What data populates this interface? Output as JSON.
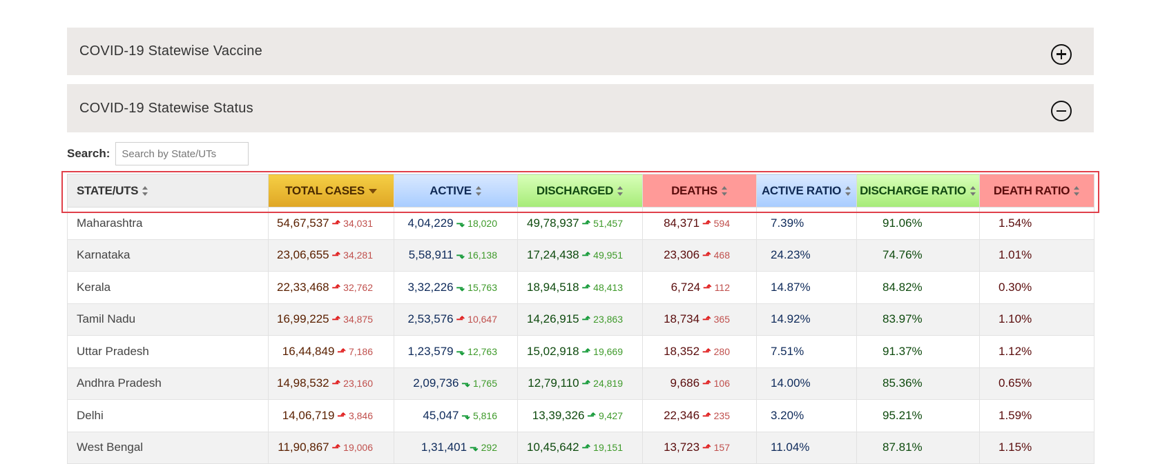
{
  "accordions": [
    {
      "title": "COVID-19 Statewise Vaccine",
      "icon": "plus-circle-icon"
    },
    {
      "title": "COVID-19 Statewise Status",
      "icon": "minus-circle-icon"
    }
  ],
  "search": {
    "label": "Search:",
    "placeholder": "Search by State/UTs",
    "value": ""
  },
  "table": {
    "headers": {
      "state": "STATE/UTS",
      "total": "TOTAL CASES",
      "active": "ACTIVE",
      "discharged": "DISCHARGED",
      "deaths": "DEATHS",
      "active_ratio": "ACTIVE RATIO",
      "discharge_ratio": "DISCHARGE RATIO",
      "death_ratio": "DEATH RATIO"
    },
    "rows": [
      {
        "state": "Maharashtra",
        "total": "54,67,537",
        "total_delta": "34,031",
        "active": "4,04,229",
        "active_delta": "18,020",
        "active_dir": "down",
        "discharged": "49,78,937",
        "discharged_delta": "51,457",
        "deaths": "84,371",
        "deaths_delta": "594",
        "active_ratio": "7.39%",
        "discharge_ratio": "91.06%",
        "death_ratio": "1.54%"
      },
      {
        "state": "Karnataka",
        "total": "23,06,655",
        "total_delta": "34,281",
        "active": "5,58,911",
        "active_delta": "16,138",
        "active_dir": "down",
        "discharged": "17,24,438",
        "discharged_delta": "49,951",
        "deaths": "23,306",
        "deaths_delta": "468",
        "active_ratio": "24.23%",
        "discharge_ratio": "74.76%",
        "death_ratio": "1.01%"
      },
      {
        "state": "Kerala",
        "total": "22,33,468",
        "total_delta": "32,762",
        "active": "3,32,226",
        "active_delta": "15,763",
        "active_dir": "down",
        "discharged": "18,94,518",
        "discharged_delta": "48,413",
        "deaths": "6,724",
        "deaths_delta": "112",
        "active_ratio": "14.87%",
        "discharge_ratio": "84.82%",
        "death_ratio": "0.30%"
      },
      {
        "state": "Tamil Nadu",
        "total": "16,99,225",
        "total_delta": "34,875",
        "active": "2,53,576",
        "active_delta": "10,647",
        "active_dir": "up",
        "discharged": "14,26,915",
        "discharged_delta": "23,863",
        "deaths": "18,734",
        "deaths_delta": "365",
        "active_ratio": "14.92%",
        "discharge_ratio": "83.97%",
        "death_ratio": "1.10%"
      },
      {
        "state": "Uttar Pradesh",
        "total": "16,44,849",
        "total_delta": "7,186",
        "active": "1,23,579",
        "active_delta": "12,763",
        "active_dir": "down",
        "discharged": "15,02,918",
        "discharged_delta": "19,669",
        "deaths": "18,352",
        "deaths_delta": "280",
        "active_ratio": "7.51%",
        "discharge_ratio": "91.37%",
        "death_ratio": "1.12%"
      },
      {
        "state": "Andhra Pradesh",
        "total": "14,98,532",
        "total_delta": "23,160",
        "active": "2,09,736",
        "active_delta": "1,765",
        "active_dir": "down",
        "discharged": "12,79,110",
        "discharged_delta": "24,819",
        "deaths": "9,686",
        "deaths_delta": "106",
        "active_ratio": "14.00%",
        "discharge_ratio": "85.36%",
        "death_ratio": "0.65%"
      },
      {
        "state": "Delhi",
        "total": "14,06,719",
        "total_delta": "3,846",
        "active": "45,047",
        "active_delta": "5,816",
        "active_dir": "down",
        "discharged": "13,39,326",
        "discharged_delta": "9,427",
        "deaths": "22,346",
        "deaths_delta": "235",
        "active_ratio": "3.20%",
        "discharge_ratio": "95.21%",
        "death_ratio": "1.59%"
      },
      {
        "state": "West Bengal",
        "total": "11,90,867",
        "total_delta": "19,006",
        "active": "1,31,401",
        "active_delta": "292",
        "active_dir": "down",
        "discharged": "10,45,642",
        "discharged_delta": "19,151",
        "deaths": "13,723",
        "deaths_delta": "157",
        "active_ratio": "11.04%",
        "discharge_ratio": "87.81%",
        "death_ratio": "1.15%"
      }
    ]
  },
  "colors": {
    "highlight": "#e0404a",
    "up_red": "#e02020",
    "down_green": "#179b3a"
  }
}
